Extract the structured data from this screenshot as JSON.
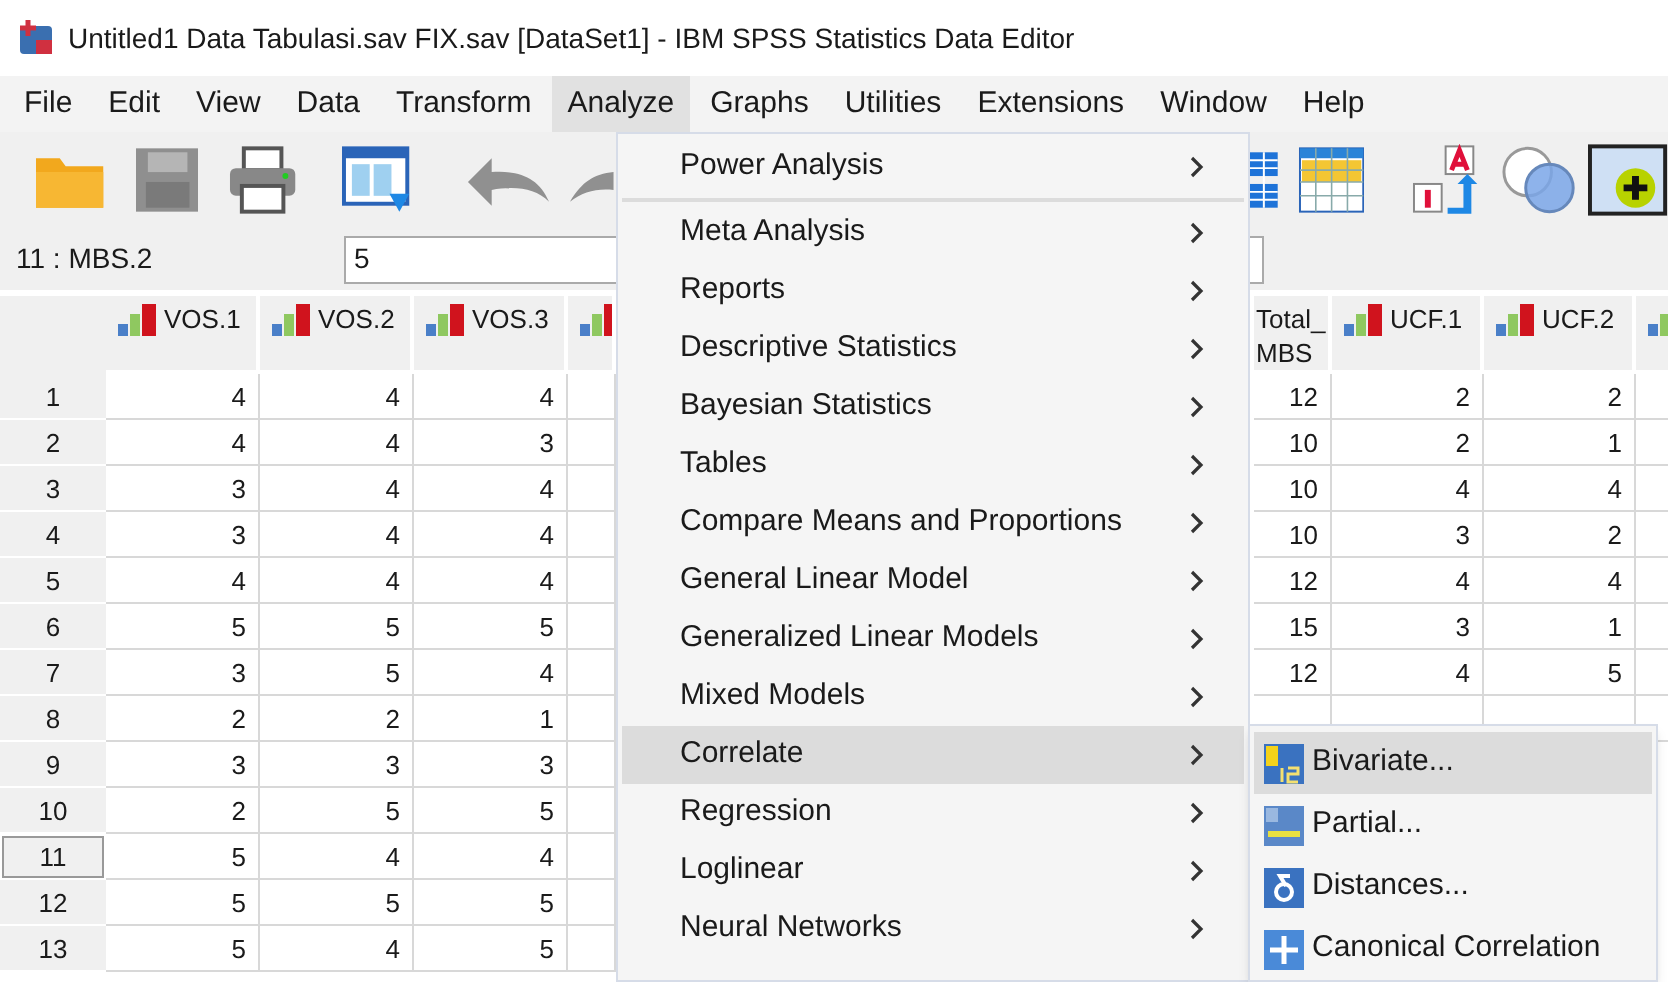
{
  "window": {
    "title": "Untitled1 Data Tabulasi.sav FIX.sav [DataSet1] - IBM SPSS Statistics Data Editor"
  },
  "menu_bar": [
    {
      "label": "File",
      "selected": false
    },
    {
      "label": "Edit",
      "selected": false
    },
    {
      "label": "View",
      "selected": false
    },
    {
      "label": "Data",
      "selected": false
    },
    {
      "label": "Transform",
      "selected": false
    },
    {
      "label": "Analyze",
      "selected": true
    },
    {
      "label": "Graphs",
      "selected": false
    },
    {
      "label": "Utilities",
      "selected": false
    },
    {
      "label": "Extensions",
      "selected": false
    },
    {
      "label": "Window",
      "selected": false
    },
    {
      "label": "Help",
      "selected": false
    }
  ],
  "cell_editor": {
    "cell": "11 : MBS.2",
    "value": "5"
  },
  "grid": {
    "left_columns": [
      {
        "name": "VOS.1",
        "kind": "scale"
      },
      {
        "name": "VOS.2",
        "kind": "scale"
      },
      {
        "name": "VOS.3",
        "kind": "scale"
      },
      {
        "kind": "scale"
      }
    ],
    "rows": [
      {
        "number": "1",
        "selected": false,
        "cells": [
          "4",
          "4",
          "4"
        ]
      },
      {
        "number": "2",
        "selected": false,
        "cells": [
          "4",
          "4",
          "3"
        ]
      },
      {
        "number": "3",
        "selected": false,
        "cells": [
          "3",
          "4",
          "4"
        ]
      },
      {
        "number": "4",
        "selected": false,
        "cells": [
          "3",
          "4",
          "4"
        ]
      },
      {
        "number": "5",
        "selected": false,
        "cells": [
          "4",
          "4",
          "4"
        ]
      },
      {
        "number": "6",
        "selected": false,
        "cells": [
          "5",
          "5",
          "5"
        ]
      },
      {
        "number": "7",
        "selected": false,
        "cells": [
          "3",
          "5",
          "4"
        ]
      },
      {
        "number": "8",
        "selected": false,
        "cells": [
          "2",
          "2",
          "1"
        ]
      },
      {
        "number": "9",
        "selected": false,
        "cells": [
          "3",
          "3",
          "3"
        ]
      },
      {
        "number": "10",
        "selected": false,
        "cells": [
          "2",
          "5",
          "5"
        ]
      },
      {
        "number": "11",
        "selected": true,
        "cells": [
          "5",
          "4",
          "4"
        ]
      },
      {
        "number": "12",
        "selected": false,
        "cells": [
          "5",
          "5",
          "5"
        ]
      },
      {
        "number": "13",
        "selected": false,
        "cells": [
          "5",
          "4",
          "5"
        ]
      }
    ],
    "right_columns": [
      {
        "name": "Total_ MBS",
        "kind": "plain"
      },
      {
        "name": "UCF.1",
        "kind": "scale"
      },
      {
        "name": "UCF.2",
        "kind": "scale"
      },
      {
        "kind": "scale"
      }
    ],
    "right_rows": [
      [
        "12",
        "2",
        "2"
      ],
      [
        "10",
        "2",
        "1"
      ],
      [
        "10",
        "4",
        "4"
      ],
      [
        "10",
        "3",
        "2"
      ],
      [
        "12",
        "4",
        "4"
      ],
      [
        "15",
        "3",
        "1"
      ],
      [
        "12",
        "4",
        "5"
      ]
    ]
  },
  "analyze_menu": {
    "groups": [
      [
        {
          "label": "Power Analysis",
          "selected": false
        }
      ],
      [
        {
          "label": "Meta Analysis",
          "selected": false
        },
        {
          "label": "Reports",
          "selected": false
        },
        {
          "label": "Descriptive Statistics",
          "selected": false
        },
        {
          "label": "Bayesian Statistics",
          "selected": false
        },
        {
          "label": "Tables",
          "selected": false
        },
        {
          "label": "Compare Means and Proportions",
          "selected": false
        },
        {
          "label": "General Linear Model",
          "selected": false
        },
        {
          "label": "Generalized Linear Models",
          "selected": false
        },
        {
          "label": "Mixed Models",
          "selected": false
        },
        {
          "label": "Correlate",
          "selected": true
        },
        {
          "label": "Regression",
          "selected": false
        },
        {
          "label": "Loglinear",
          "selected": false
        },
        {
          "label": "Neural Networks",
          "selected": false
        }
      ]
    ]
  },
  "correlate_submenu": [
    {
      "label": "Bivariate...",
      "kind": "bivariate",
      "selected": true
    },
    {
      "label": "Partial...",
      "kind": "partial",
      "selected": false
    },
    {
      "label": "Distances...",
      "kind": "distances",
      "selected": false
    },
    {
      "label": "Canonical Correlation",
      "kind": "canonical",
      "selected": false
    }
  ]
}
